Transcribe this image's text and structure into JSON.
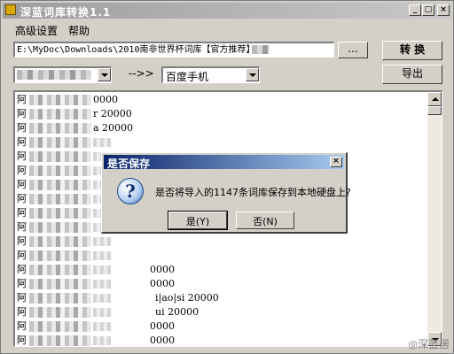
{
  "window": {
    "title": "深蓝词库转换1.1",
    "controls": {
      "minimize": "_",
      "maximize": "□",
      "close": "×"
    }
  },
  "menu": {
    "items": [
      "高级设置",
      "帮助"
    ]
  },
  "toolbar": {
    "path_value": "E:\\MyDoc\\Downloads\\2010南非世界杯词库【官方推荐】",
    "browse_label": "...",
    "convert_label": "转 换",
    "export_label": "导出",
    "arrow_label": "-->>",
    "target_format": "百度手机"
  },
  "list": {
    "rows": [
      {
        "first": "阿",
        "tail": "0000"
      },
      {
        "first": "阿",
        "tail": "r 20000"
      },
      {
        "first": "阿",
        "tail": "a 20000"
      },
      {
        "first": "阿",
        "tail": ""
      },
      {
        "first": "阿",
        "tail": ""
      },
      {
        "first": "阿",
        "tail": ""
      },
      {
        "first": "阿",
        "tail": ""
      },
      {
        "first": "阿",
        "tail": ""
      },
      {
        "first": "阿",
        "tail": ""
      },
      {
        "first": "阿",
        "tail": ""
      },
      {
        "first": "阿",
        "tail": ""
      },
      {
        "first": "阿",
        "tail": ""
      },
      {
        "first": "阿",
        "tail": "0000"
      },
      {
        "first": "阿",
        "tail": "0000"
      },
      {
        "first": "阿",
        "tail": "i|ao|si 20000"
      },
      {
        "first": "阿",
        "tail": "ui 20000"
      },
      {
        "first": "阿",
        "tail": "0000"
      },
      {
        "first": "阿",
        "tail": "0000"
      }
    ]
  },
  "dialog": {
    "title": "是否保存",
    "close": "×",
    "icon": "question-icon",
    "message": "是否将导入的1147条词库保存到本地硬盘上?",
    "yes_label": "是(Y)",
    "no_label": "否(N)"
  },
  "watermark": "◎深蓝居"
}
